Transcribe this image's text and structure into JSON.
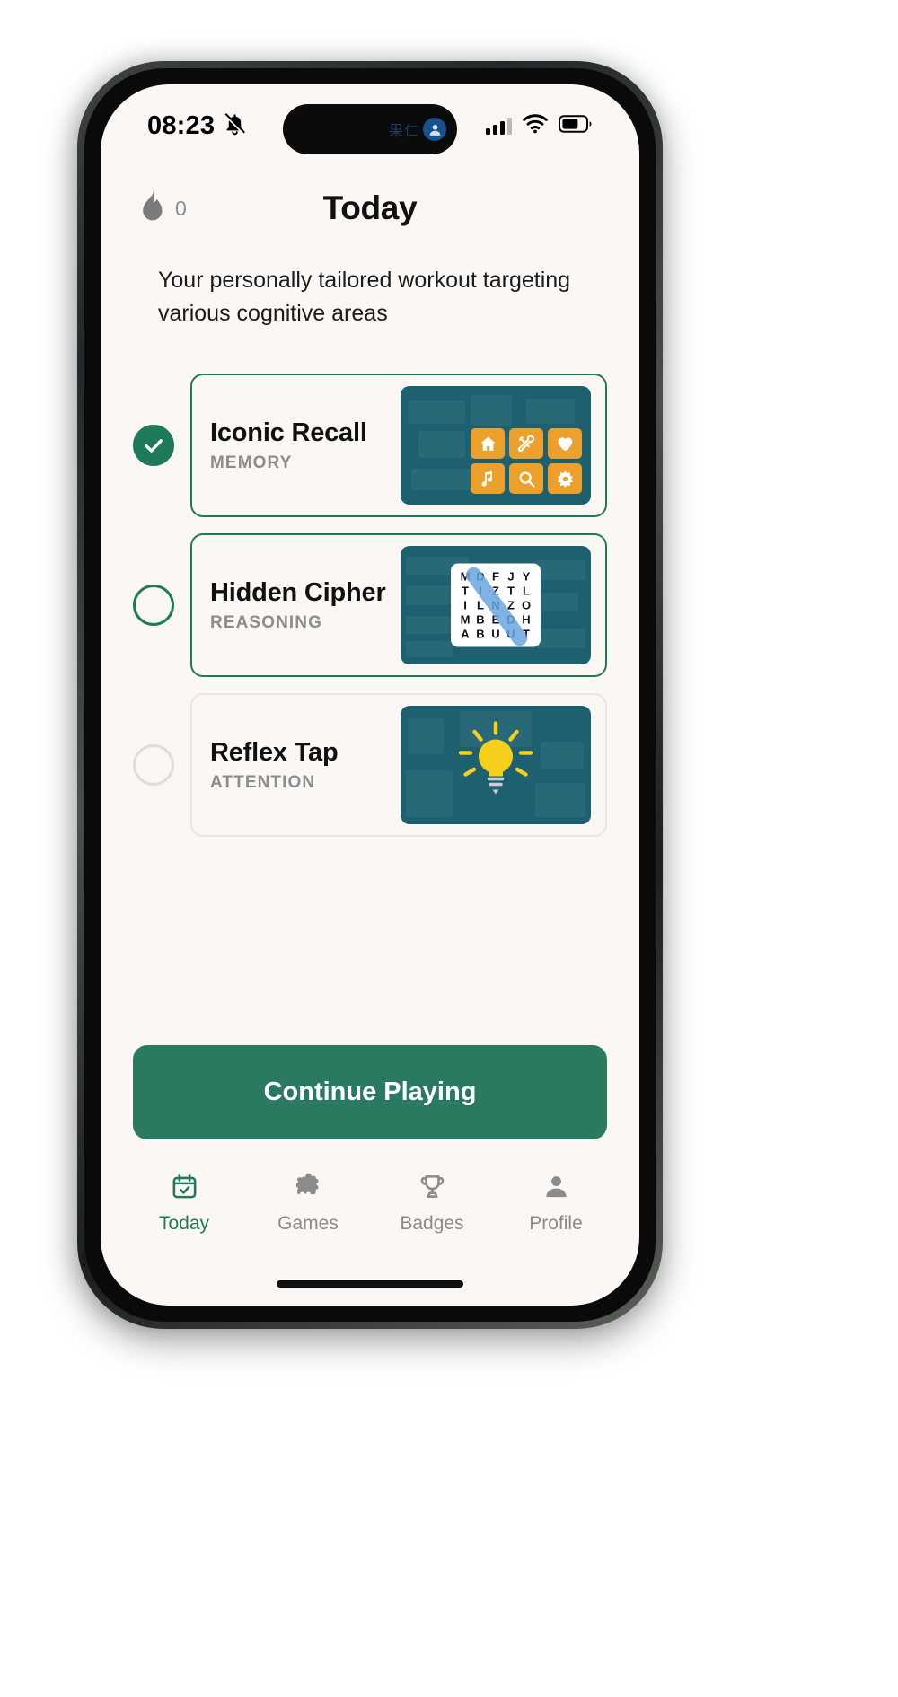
{
  "status_bar": {
    "time": "08:23",
    "silent_icon": "bell-slash-icon",
    "signal_icon": "cellular-bars-icon",
    "wifi_icon": "wifi-icon",
    "battery_icon": "battery-icon",
    "dynamic_island": {
      "text": "果仁",
      "badge_icon": "person-badge-icon"
    }
  },
  "header": {
    "streak_icon": "flame-icon",
    "streak_count": "0",
    "title": "Today"
  },
  "subtitle": "Your personally tailored workout targeting various cognitive areas",
  "tasks": [
    {
      "title": "Iconic Recall",
      "category": "MEMORY",
      "state": "completed",
      "bullet_icon": "check-circle-filled-icon",
      "thumbnail": {
        "type": "icon-tiles",
        "tiles": [
          "home-icon",
          "tools-icon",
          "heart-icon",
          "music-note-icon",
          "search-icon",
          "star-burst-icon"
        ]
      }
    },
    {
      "title": "Hidden Cipher",
      "category": "REASONING",
      "state": "current",
      "bullet_icon": "circle-outline-icon",
      "thumbnail": {
        "type": "word-search",
        "rows": [
          [
            "M",
            "D",
            "F",
            "J",
            "Y"
          ],
          [
            "T",
            "I",
            "Z",
            "T",
            "L"
          ],
          [
            "I",
            "L",
            "N",
            "Z",
            "O"
          ],
          [
            "M",
            "B",
            "E",
            "D",
            "H"
          ],
          [
            "A",
            "B",
            "U",
            "U",
            "T"
          ]
        ]
      }
    },
    {
      "title": "Reflex Tap",
      "category": "ATTENTION",
      "state": "locked",
      "bullet_icon": "circle-outline-idle-icon",
      "thumbnail": {
        "type": "lightbulb",
        "icon": "lightbulb-icon"
      }
    }
  ],
  "cta": {
    "label": "Continue Playing"
  },
  "tabbar": [
    {
      "label": "Today",
      "icon": "calendar-check-icon",
      "active": true
    },
    {
      "label": "Games",
      "icon": "puzzle-piece-icon",
      "active": false
    },
    {
      "label": "Badges",
      "icon": "trophy-icon",
      "active": false
    },
    {
      "label": "Profile",
      "icon": "person-icon",
      "active": false
    }
  ],
  "colors": {
    "accent_green": "#1f7a5c",
    "cta_green": "#2a7a62",
    "thumb_teal": "#1d6170",
    "tile_orange": "#eda02c",
    "bulb_yellow": "#f5cf1c",
    "screen_bg": "#faf7f4",
    "muted_text": "#8c8c8c"
  }
}
